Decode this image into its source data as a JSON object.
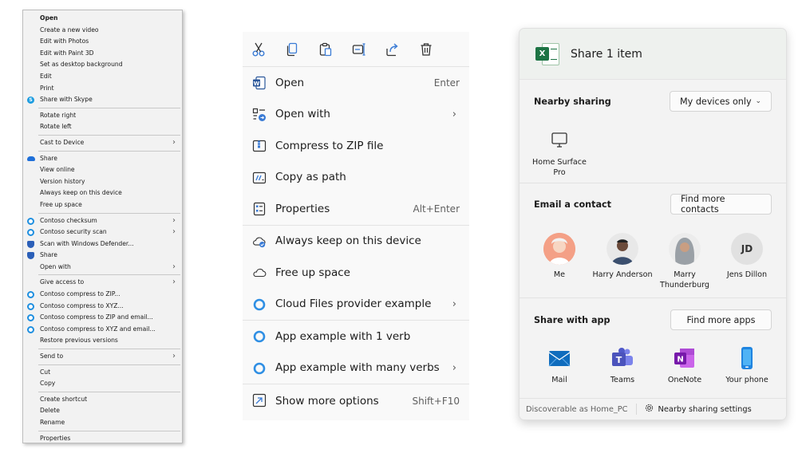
{
  "legacy_menu": {
    "items": [
      {
        "label": "Open",
        "bold": true
      },
      {
        "label": "Create a new video"
      },
      {
        "label": "Edit with Photos"
      },
      {
        "label": "Edit with Paint 3D"
      },
      {
        "label": "Set as desktop background"
      },
      {
        "label": "Edit"
      },
      {
        "label": "Print"
      },
      {
        "label": "Share with Skype",
        "icon": "skype-icon"
      },
      {
        "sep": true
      },
      {
        "label": "Rotate right"
      },
      {
        "label": "Rotate left"
      },
      {
        "sep": true
      },
      {
        "label": "Cast to Device",
        "submenu": true
      },
      {
        "sep": true
      },
      {
        "label": "Share",
        "icon": "onedrive-cloud-icon"
      },
      {
        "label": "View online"
      },
      {
        "label": "Version history"
      },
      {
        "label": "Always keep on this device"
      },
      {
        "label": "Free up space"
      },
      {
        "sep": true
      },
      {
        "label": "Contoso checksum",
        "icon": "contoso-ring-icon",
        "submenu": true
      },
      {
        "label": "Contoso security scan",
        "icon": "contoso-ring-icon",
        "submenu": true
      },
      {
        "label": "Scan with Windows Defender...",
        "icon": "defender-shield-icon"
      },
      {
        "label": "Share",
        "icon": "share-icon"
      },
      {
        "label": "Open with",
        "submenu": true
      },
      {
        "sep": true
      },
      {
        "label": "Give access to",
        "submenu": true
      },
      {
        "label": "Contoso compress to ZIP...",
        "icon": "contoso-ring-icon"
      },
      {
        "label": "Contoso compress to XYZ...",
        "icon": "contoso-ring-icon"
      },
      {
        "label": "Contoso compress to ZIP and email...",
        "icon": "contoso-ring-icon"
      },
      {
        "label": "Contoso compress to XYZ and email...",
        "icon": "contoso-ring-icon"
      },
      {
        "label": "Restore previous versions"
      },
      {
        "sep": true
      },
      {
        "label": "Send to",
        "submenu": true
      },
      {
        "sep": true
      },
      {
        "label": "Cut"
      },
      {
        "label": "Copy"
      },
      {
        "sep": true
      },
      {
        "label": "Create shortcut"
      },
      {
        "label": "Delete"
      },
      {
        "label": "Rename"
      },
      {
        "sep": true
      },
      {
        "label": "Properties"
      }
    ]
  },
  "win11_menu": {
    "toolbar": [
      "cut-icon",
      "copy-icon",
      "paste-icon",
      "rename-icon",
      "share-icon",
      "delete-icon"
    ],
    "group1": [
      {
        "label": "Open",
        "shortcut": "Enter",
        "icon": "word-doc-icon"
      },
      {
        "label": "Open with",
        "chevron": true,
        "icon": "open-with-icon"
      },
      {
        "label": "Compress to ZIP file",
        "icon": "zip-folder-icon"
      },
      {
        "label": "Copy as path",
        "icon": "copy-path-icon"
      },
      {
        "label": "Properties",
        "shortcut": "Alt+Enter",
        "icon": "properties-icon"
      }
    ],
    "group2": [
      {
        "label": "Always keep on this device",
        "icon": "cloud-sync-icon"
      },
      {
        "label": "Free up space",
        "icon": "cloud-icon"
      },
      {
        "label": "Cloud Files provider example",
        "chevron": true,
        "icon": "provider-ring-icon"
      }
    ],
    "group3": [
      {
        "label": "App example with 1 verb",
        "icon": "app-ring-icon"
      },
      {
        "label": "App example with many verbs",
        "chevron": true,
        "icon": "app-ring-icon"
      }
    ],
    "group4": [
      {
        "label": "Show more options",
        "shortcut": "Shift+F10",
        "icon": "show-more-icon"
      }
    ]
  },
  "share_dialog": {
    "title": "Share 1 item",
    "nearby": {
      "title": "Nearby sharing",
      "dropdown_value": "My devices only",
      "device": "Home Surface Pro"
    },
    "email": {
      "title": "Email a contact",
      "button": "Find more contacts",
      "contacts": [
        {
          "name": "Me",
          "color": "#e8705a"
        },
        {
          "name": "Harry Anderson",
          "color": "#6b4a3a"
        },
        {
          "name": "Marry Thunderburg",
          "color": "#8a8f95"
        },
        {
          "name": "Jens Dillon",
          "initials": "JD",
          "color": "#e3e3e3"
        }
      ]
    },
    "apps": {
      "title": "Share with app",
      "button": "Find more apps",
      "items": [
        {
          "name": "Mail",
          "icon": "mail-icon"
        },
        {
          "name": "Teams",
          "icon": "teams-icon"
        },
        {
          "name": "OneNote",
          "icon": "onenote-icon"
        },
        {
          "name": "Your phone",
          "icon": "phone-icon"
        }
      ]
    },
    "footer": {
      "discoverable": "Discoverable as Home_PC",
      "settings": "Nearby sharing settings"
    }
  }
}
